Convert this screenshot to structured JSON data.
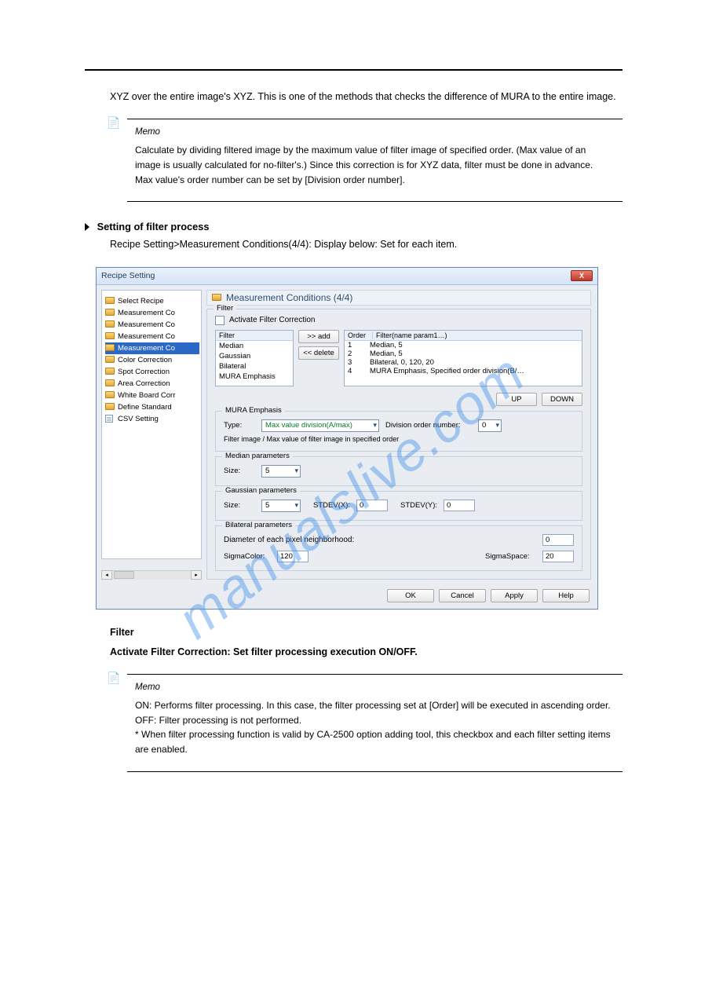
{
  "watermark": "manualslive.com",
  "intro_text": "XYZ over the entire image's XYZ. This is one of the methods that checks the difference of MURA to the entire image.",
  "note1": {
    "title": "Memo",
    "text": "Calculate by dividing filtered image by the maximum value of filter image of specified order. (Max value of an image is usually calculated for no-filter's.) Since this correction is for XYZ data, filter must be done in advance. Max value's order number can be set by [Division order number]."
  },
  "section_title": "Setting of filter process",
  "screenshot_desc": "Recipe Setting>Measurement Conditions(4/4): Display below: Set for each item.",
  "dlg": {
    "title": "Recipe Setting",
    "close": "X",
    "tree": [
      "Select Recipe",
      "Measurement Co",
      "Measurement Co",
      "Measurement Co",
      "Measurement Co",
      "Color Correction",
      "Spot Correction",
      "Area Correction",
      "White Board Corr",
      "Define Standard",
      "CSV Setting"
    ],
    "crumb": "Measurement Conditions (4/4)",
    "filter": {
      "group": "Filter",
      "activate": "Activate Filter Correction",
      "left_hdr": "Filter",
      "left_items": [
        "Median",
        "Gaussian",
        "Bilateral",
        "MURA Emphasis"
      ],
      "add": ">> add",
      "delete": "<< delete",
      "right_hdr_order": "Order",
      "right_hdr_name": "Filter(name param1…)",
      "right_rows": [
        {
          "order": "1",
          "text": "Median,  5"
        },
        {
          "order": "2",
          "text": "Median,  5"
        },
        {
          "order": "3",
          "text": "Bilateral,  0,  120,  20"
        },
        {
          "order": "4",
          "text": "MURA Emphasis, Specified order division(B/…"
        }
      ],
      "up": "UP",
      "down": "DOWN"
    },
    "mura": {
      "group": "MURA Emphasis",
      "type_lbl": "Type:",
      "type_val": "Max value division(A/max)",
      "div_lbl": "Division order number:",
      "div_val": "0",
      "hint": "Filter image / Max value of filter image in specified order"
    },
    "median": {
      "group": "Median parameters",
      "size_lbl": "Size:",
      "size_val": "5"
    },
    "gaussian": {
      "group": "Gaussian parameters",
      "size_lbl": "Size:",
      "size_val": "5",
      "stdx_lbl": "STDEV(X):",
      "stdx_val": "0",
      "stdy_lbl": "STDEV(Y):",
      "stdy_val": "0"
    },
    "bilateral": {
      "group": "Bilateral parameters",
      "diam_lbl": "Diameter of each pixel neighborhood:",
      "diam_val": "0",
      "sigcolor_lbl": "SigmaColor:",
      "sigcolor_val": "120",
      "sigspace_lbl": "SigmaSpace:",
      "sigspace_val": "20"
    },
    "buttons": {
      "ok": "OK",
      "cancel": "Cancel",
      "apply": "Apply",
      "help": "Help"
    }
  },
  "filter_bold": "Filter",
  "activate_bold": "Activate Filter Correction: Set filter processing execution ON/OFF.",
  "note2": {
    "title": "Memo",
    "text": "ON: Performs filter processing. In this case, the filter processing set at [Order] will be executed in ascending order.\nOFF: Filter processing is not performed.\n* When filter processing function is valid by CA-2500 option adding tool, this checkbox and each filter setting items are enabled."
  }
}
